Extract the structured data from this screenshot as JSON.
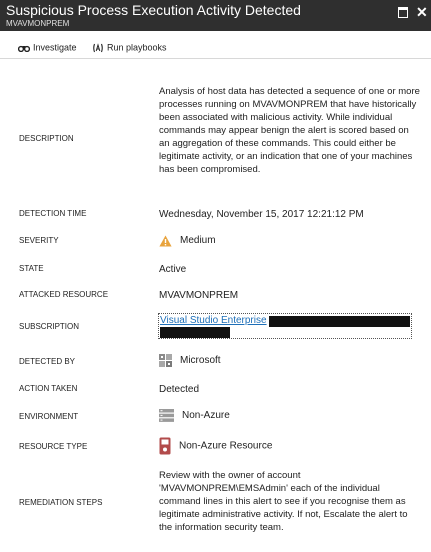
{
  "header": {
    "title": "Suspicious Process Execution Activity Detected",
    "subtitle": "MVAVMONPREM",
    "maximize_icon": "maximize-icon",
    "close_glyph": "✕"
  },
  "toolbar": {
    "investigate_label": "Investigate",
    "investigate_icon": "binoculars-icon",
    "playbooks_label": "Run playbooks",
    "playbooks_icon": "playbook-icon"
  },
  "details": {
    "description": {
      "label": "DESCRIPTION",
      "value": "Analysis of host data has detected a sequence of one or more processes running on MVAVMONPREM that have historically been associated with malicious activity. While individual commands may appear benign the alert is scored based on an aggregation of these commands. This could either be legitimate activity, or an indication that one of your machines has been compromised."
    },
    "detection_time": {
      "label": "DETECTION TIME",
      "value": "Wednesday, November 15, 2017 12:21:12 PM"
    },
    "severity": {
      "label": "SEVERITY",
      "value": "Medium",
      "icon": "warning-icon",
      "icon_color": "#e8a33d"
    },
    "state": {
      "label": "STATE",
      "value": "Active"
    },
    "attacked_resource": {
      "label": "ATTACKED RESOURCE",
      "value": "MVAVMONPREM"
    },
    "subscription": {
      "label": "SUBSCRIPTION",
      "value": "Visual Studio Enterprise",
      "link_color": "#1e6fb8"
    },
    "detected_by": {
      "label": "DETECTED BY",
      "value": "Microsoft",
      "icon": "microsoft-logo-icon"
    },
    "action_taken": {
      "label": "ACTION TAKEN",
      "value": "Detected"
    },
    "environment": {
      "label": "ENVIRONMENT",
      "value": "Non-Azure",
      "icon": "server-icon"
    },
    "resource_type": {
      "label": "RESOURCE TYPE",
      "value": "Non-Azure Resource",
      "icon": "resource-icon",
      "icon_color": "#b24b4b"
    },
    "remediation_steps": {
      "label": "REMEDIATION STEPS",
      "value": "Review with the owner of account 'MVAVMONPREM\\EMSAdmin' each of the individual command lines in this alert to see if you recognise them as legitimate administrative activity. If not, Escalate the alert to the information security team."
    }
  }
}
